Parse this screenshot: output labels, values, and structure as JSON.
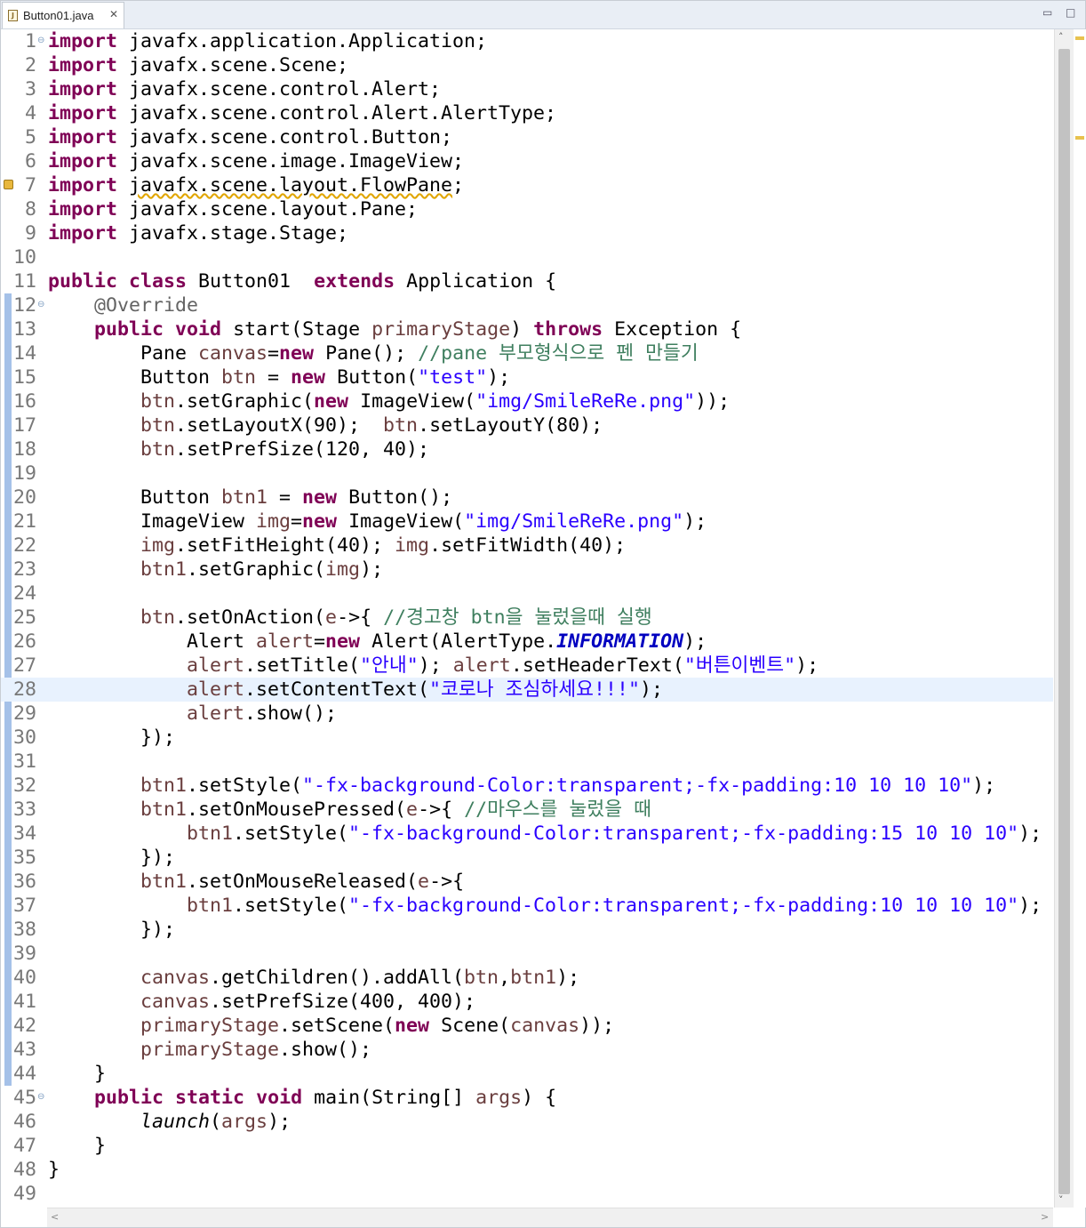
{
  "tab": {
    "title": "Button01.java",
    "file_icon": "java-file-icon",
    "close_glyph": "✕"
  },
  "window_controls": {
    "minimize_glyph": "▭",
    "maximize_glyph": "□"
  },
  "editor": {
    "current_line": 28,
    "warning_line": 7,
    "lines": [
      {
        "n": "1",
        "fold": "⊖",
        "t": [
          [
            "kw",
            "import"
          ],
          [
            "",
            " javafx.application.Application;"
          ]
        ]
      },
      {
        "n": "2",
        "t": [
          [
            "kw",
            "import"
          ],
          [
            "",
            " javafx.scene.Scene;"
          ]
        ]
      },
      {
        "n": "3",
        "t": [
          [
            "kw",
            "import"
          ],
          [
            "",
            " javafx.scene.control.Alert;"
          ]
        ]
      },
      {
        "n": "4",
        "t": [
          [
            "kw",
            "import"
          ],
          [
            "",
            " javafx.scene.control.Alert.AlertType;"
          ]
        ]
      },
      {
        "n": "5",
        "t": [
          [
            "kw",
            "import"
          ],
          [
            "",
            " javafx.scene.control.Button;"
          ]
        ]
      },
      {
        "n": "6",
        "t": [
          [
            "kw",
            "import"
          ],
          [
            "",
            " javafx.scene.image.ImageView;"
          ]
        ]
      },
      {
        "n": "7",
        "t": [
          [
            "kw",
            "import"
          ],
          [
            "",
            " "
          ],
          [
            "squig",
            "javafx.scene.layout.FlowPane"
          ],
          [
            "",
            ";"
          ]
        ]
      },
      {
        "n": "8",
        "t": [
          [
            "kw",
            "import"
          ],
          [
            "",
            " javafx.scene.layout.Pane;"
          ]
        ]
      },
      {
        "n": "9",
        "t": [
          [
            "kw",
            "import"
          ],
          [
            "",
            " javafx.stage.Stage;"
          ]
        ]
      },
      {
        "n": "10",
        "t": []
      },
      {
        "n": "11",
        "t": [
          [
            "kw",
            "public"
          ],
          [
            "",
            " "
          ],
          [
            "kw",
            "class"
          ],
          [
            "",
            " Button01  "
          ],
          [
            "kw",
            "extends"
          ],
          [
            "",
            " Application {"
          ]
        ]
      },
      {
        "n": "12",
        "fold": "⊖",
        "t": [
          [
            "",
            "    "
          ],
          [
            "ann",
            "@Override"
          ]
        ]
      },
      {
        "n": "13",
        "t": [
          [
            "",
            "    "
          ],
          [
            "kw",
            "public"
          ],
          [
            "",
            " "
          ],
          [
            "kw",
            "void"
          ],
          [
            "",
            " start(Stage "
          ],
          [
            "fld",
            "primaryStage"
          ],
          [
            "",
            ") "
          ],
          [
            "kw",
            "throws"
          ],
          [
            "",
            " Exception {"
          ]
        ]
      },
      {
        "n": "14",
        "t": [
          [
            "",
            "        Pane "
          ],
          [
            "fld",
            "canvas"
          ],
          [
            "",
            "="
          ],
          [
            "kw",
            "new"
          ],
          [
            "",
            " Pane(); "
          ],
          [
            "cmt",
            "//pane 부모형식으로 펜 만들기"
          ]
        ]
      },
      {
        "n": "15",
        "t": [
          [
            "",
            "        Button "
          ],
          [
            "fld",
            "btn"
          ],
          [
            "",
            " = "
          ],
          [
            "kw",
            "new"
          ],
          [
            "",
            " Button("
          ],
          [
            "str",
            "\"test\""
          ],
          [
            "",
            ");"
          ]
        ]
      },
      {
        "n": "16",
        "t": [
          [
            "",
            "        "
          ],
          [
            "fld",
            "btn"
          ],
          [
            "",
            ".setGraphic("
          ],
          [
            "kw",
            "new"
          ],
          [
            "",
            " ImageView("
          ],
          [
            "str",
            "\"img/SmileReRe.png\""
          ],
          [
            "",
            "));"
          ]
        ]
      },
      {
        "n": "17",
        "t": [
          [
            "",
            "        "
          ],
          [
            "fld",
            "btn"
          ],
          [
            "",
            ".setLayoutX(90);  "
          ],
          [
            "fld",
            "btn"
          ],
          [
            "",
            ".setLayoutY(80);"
          ]
        ]
      },
      {
        "n": "18",
        "t": [
          [
            "",
            "        "
          ],
          [
            "fld",
            "btn"
          ],
          [
            "",
            ".setPrefSize(120, 40);"
          ]
        ]
      },
      {
        "n": "19",
        "t": []
      },
      {
        "n": "20",
        "t": [
          [
            "",
            "        Button "
          ],
          [
            "fld",
            "btn1"
          ],
          [
            "",
            " = "
          ],
          [
            "kw",
            "new"
          ],
          [
            "",
            " Button();"
          ]
        ]
      },
      {
        "n": "21",
        "t": [
          [
            "",
            "        ImageView "
          ],
          [
            "fld",
            "img"
          ],
          [
            "",
            "="
          ],
          [
            "kw",
            "new"
          ],
          [
            "",
            " ImageView("
          ],
          [
            "str",
            "\"img/SmileReRe.png\""
          ],
          [
            "",
            ");"
          ]
        ]
      },
      {
        "n": "22",
        "t": [
          [
            "",
            "        "
          ],
          [
            "fld",
            "img"
          ],
          [
            "",
            ".setFitHeight(40); "
          ],
          [
            "fld",
            "img"
          ],
          [
            "",
            ".setFitWidth(40);"
          ]
        ]
      },
      {
        "n": "23",
        "t": [
          [
            "",
            "        "
          ],
          [
            "fld",
            "btn1"
          ],
          [
            "",
            ".setGraphic("
          ],
          [
            "fld",
            "img"
          ],
          [
            "",
            ");"
          ]
        ]
      },
      {
        "n": "24",
        "t": []
      },
      {
        "n": "25",
        "t": [
          [
            "",
            "        "
          ],
          [
            "fld",
            "btn"
          ],
          [
            "",
            ".setOnAction("
          ],
          [
            "fld",
            "e"
          ],
          [
            "",
            "->{ "
          ],
          [
            "cmt",
            "//경고창 btn을 눌렀을때 실행"
          ]
        ]
      },
      {
        "n": "26",
        "t": [
          [
            "",
            "            Alert "
          ],
          [
            "fld",
            "alert"
          ],
          [
            "",
            "="
          ],
          [
            "kw",
            "new"
          ],
          [
            "",
            " Alert(AlertType."
          ],
          [
            "cst",
            "INFORMATION"
          ],
          [
            "",
            ");"
          ]
        ]
      },
      {
        "n": "27",
        "t": [
          [
            "",
            "            "
          ],
          [
            "fld",
            "alert"
          ],
          [
            "",
            ".setTitle("
          ],
          [
            "str",
            "\"안내\""
          ],
          [
            "",
            "); "
          ],
          [
            "fld",
            "alert"
          ],
          [
            "",
            ".setHeaderText("
          ],
          [
            "str",
            "\"버튼이벤트\""
          ],
          [
            "",
            ");"
          ]
        ]
      },
      {
        "n": "28",
        "t": [
          [
            "",
            "            "
          ],
          [
            "fld",
            "alert"
          ],
          [
            "",
            ".setContentText("
          ],
          [
            "str",
            "\"코로나 조심하세요!!!\""
          ],
          [
            "",
            ");"
          ]
        ]
      },
      {
        "n": "29",
        "t": [
          [
            "",
            "            "
          ],
          [
            "fld",
            "alert"
          ],
          [
            "",
            ".show();"
          ]
        ]
      },
      {
        "n": "30",
        "t": [
          [
            "",
            "        });"
          ]
        ]
      },
      {
        "n": "31",
        "t": []
      },
      {
        "n": "32",
        "t": [
          [
            "",
            "        "
          ],
          [
            "fld",
            "btn1"
          ],
          [
            "",
            ".setStyle("
          ],
          [
            "str",
            "\"-fx-background-Color:transparent;-fx-padding:10 10 10 10\""
          ],
          [
            "",
            ");"
          ]
        ]
      },
      {
        "n": "33",
        "t": [
          [
            "",
            "        "
          ],
          [
            "fld",
            "btn1"
          ],
          [
            "",
            ".setOnMousePressed("
          ],
          [
            "fld",
            "e"
          ],
          [
            "",
            "->{ "
          ],
          [
            "cmt",
            "//마우스를 눌렀을 때"
          ]
        ]
      },
      {
        "n": "34",
        "t": [
          [
            "",
            "            "
          ],
          [
            "fld",
            "btn1"
          ],
          [
            "",
            ".setStyle("
          ],
          [
            "str",
            "\"-fx-background-Color:transparent;-fx-padding:15 10 10 10\""
          ],
          [
            "",
            ");"
          ]
        ]
      },
      {
        "n": "35",
        "t": [
          [
            "",
            "        });"
          ]
        ]
      },
      {
        "n": "36",
        "t": [
          [
            "",
            "        "
          ],
          [
            "fld",
            "btn1"
          ],
          [
            "",
            ".setOnMouseReleased("
          ],
          [
            "fld",
            "e"
          ],
          [
            "",
            "->{"
          ]
        ]
      },
      {
        "n": "37",
        "t": [
          [
            "",
            "            "
          ],
          [
            "fld",
            "btn1"
          ],
          [
            "",
            ".setStyle("
          ],
          [
            "str",
            "\"-fx-background-Color:transparent;-fx-padding:10 10 10 10\""
          ],
          [
            "",
            ");"
          ]
        ]
      },
      {
        "n": "38",
        "t": [
          [
            "",
            "        });"
          ]
        ]
      },
      {
        "n": "39",
        "t": []
      },
      {
        "n": "40",
        "t": [
          [
            "",
            "        "
          ],
          [
            "fld",
            "canvas"
          ],
          [
            "",
            ".getChildren().addAll("
          ],
          [
            "fld",
            "btn"
          ],
          [
            "",
            ","
          ],
          [
            "fld",
            "btn1"
          ],
          [
            "",
            ");"
          ]
        ]
      },
      {
        "n": "41",
        "t": [
          [
            "",
            "        "
          ],
          [
            "fld",
            "canvas"
          ],
          [
            "",
            ".setPrefSize(400, 400);"
          ]
        ]
      },
      {
        "n": "42",
        "t": [
          [
            "",
            "        "
          ],
          [
            "fld",
            "primaryStage"
          ],
          [
            "",
            ".setScene("
          ],
          [
            "kw",
            "new"
          ],
          [
            "",
            " Scene("
          ],
          [
            "fld",
            "canvas"
          ],
          [
            "",
            "));"
          ]
        ]
      },
      {
        "n": "43",
        "t": [
          [
            "",
            "        "
          ],
          [
            "fld",
            "primaryStage"
          ],
          [
            "",
            ".show();"
          ]
        ]
      },
      {
        "n": "44",
        "t": [
          [
            "",
            "    }"
          ]
        ]
      },
      {
        "n": "45",
        "fold": "⊖",
        "t": [
          [
            "",
            "    "
          ],
          [
            "kw",
            "public"
          ],
          [
            "",
            " "
          ],
          [
            "kw",
            "static"
          ],
          [
            "",
            " "
          ],
          [
            "kw",
            "void"
          ],
          [
            "",
            " main(String[] "
          ],
          [
            "fld",
            "args"
          ],
          [
            "",
            ") {"
          ]
        ]
      },
      {
        "n": "46",
        "t": [
          [
            "",
            "        "
          ],
          [
            "ital",
            "launch"
          ],
          [
            "",
            "("
          ],
          [
            "fld",
            "args"
          ],
          [
            "",
            ");"
          ]
        ]
      },
      {
        "n": "47",
        "t": [
          [
            "",
            "    }"
          ]
        ]
      },
      {
        "n": "48",
        "t": [
          [
            "",
            "}"
          ]
        ]
      },
      {
        "n": "49",
        "t": []
      }
    ]
  },
  "scrollbars": {
    "up_glyph": "˄",
    "down_glyph": "˅",
    "left_glyph": "<",
    "right_glyph": ">"
  }
}
